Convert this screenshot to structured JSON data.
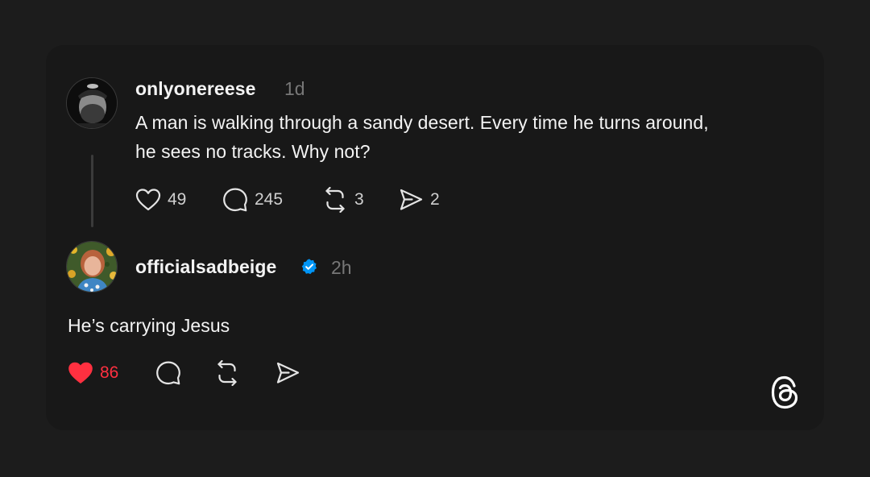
{
  "original_post": {
    "username": "onlyonereese",
    "time": "1d",
    "text_line1": "A man is walking through a sandy desert. Every time he turns around,",
    "text_line2": "he sees no tracks. Why not?",
    "likes": "49",
    "replies": "245",
    "reposts": "3",
    "shares": "2"
  },
  "reply": {
    "username": "officialsadbeige",
    "time": "2h",
    "text": "He’s carrying Jesus",
    "likes": "86"
  },
  "colors": {
    "background": "#1c1c1c",
    "card": "#181818",
    "liked": "#ff3040",
    "verified": "#0095f6"
  },
  "icons": {
    "like": "heart-icon",
    "reply": "comment-icon",
    "repost": "repost-icon",
    "share": "send-icon",
    "verified": "verified-badge-icon",
    "brand": "threads-logo"
  }
}
